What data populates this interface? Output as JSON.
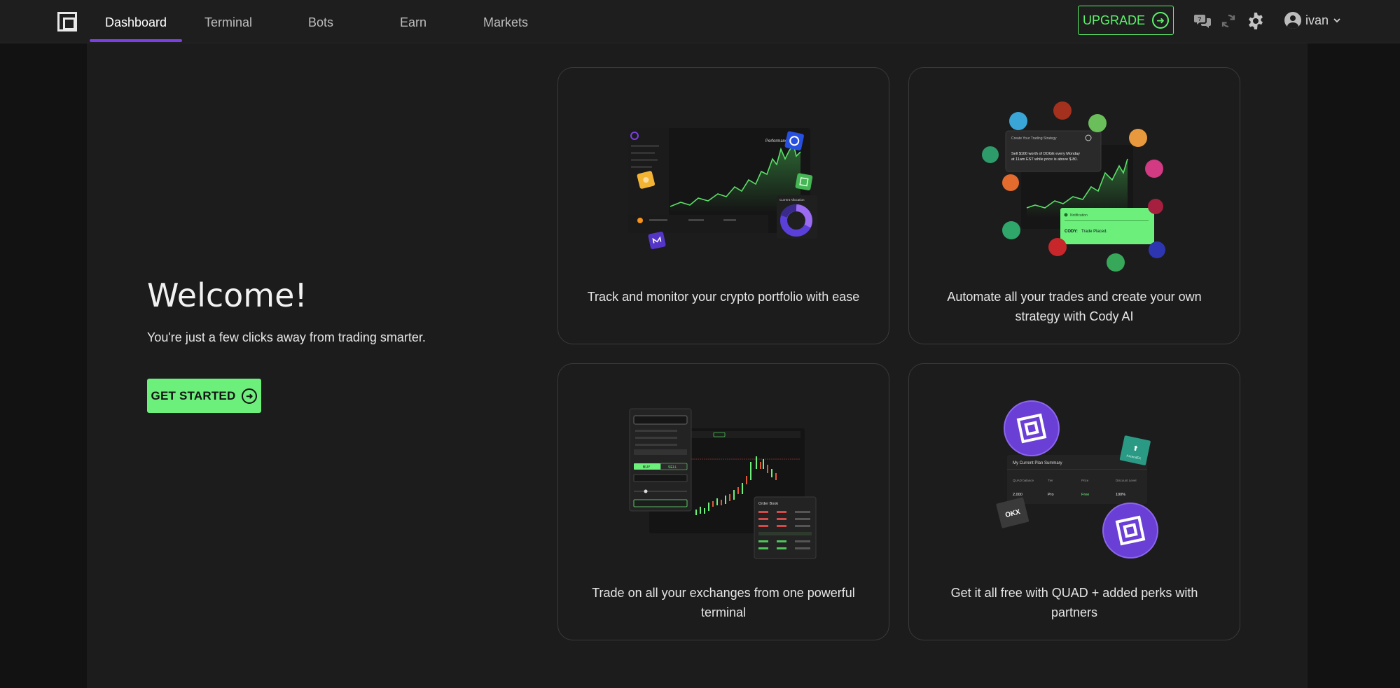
{
  "nav": {
    "items": [
      {
        "label": "Dashboard",
        "active": true
      },
      {
        "label": "Terminal"
      },
      {
        "label": "Bots"
      },
      {
        "label": "Earn"
      },
      {
        "label": "Markets"
      }
    ]
  },
  "header": {
    "upgrade_label": "UPGRADE",
    "user_name": "ivan"
  },
  "welcome": {
    "title": "Welcome!",
    "subtitle": "You're just a few clicks away from trading smarter.",
    "cta_label": "GET STARTED"
  },
  "cards": [
    {
      "text": "Track and monitor your crypto portfolio with ease"
    },
    {
      "text": "Automate all your trades and create your own strategy with Cody AI"
    },
    {
      "text": "Trade on all your exchanges from one powerful terminal"
    },
    {
      "text": "Get it all free with QUAD + added perks with partners"
    }
  ],
  "illustrations": {
    "portfolio": {
      "performance_label": "Performance",
      "allocation_label": "Current Allocation"
    },
    "cody": {
      "strategy_title": "Create Your Trading Strategy",
      "strategy_text_1": "Sell $100 worth of DOGE every Monday",
      "strategy_text_2": "at 11am EST while price is above $.80.",
      "notification_label": "Notification",
      "cody_prefix": "CODY:",
      "cody_message": "Trade Placed."
    },
    "terminal": {
      "order_book_label": "Order Book",
      "buy_label": "BUY",
      "sell_label": "SELL"
    },
    "plan": {
      "title": "My Current Plan Summary",
      "headers": [
        "QUAD balance",
        "Tier",
        "Price",
        "Discount Level"
      ],
      "values": [
        "2,000",
        "Pro",
        "Free",
        "100%"
      ],
      "okx_label": "OKX",
      "ascendex_label": "AscendEX"
    }
  },
  "colors": {
    "accent_green": "#6cf07b",
    "active_tab_purple": "#7c3fe4",
    "card_border": "#3a3a3a"
  },
  "icons": {
    "logo": "quad-logo-icon",
    "support": "chat-bubbles-icon",
    "sync": "refresh-icon",
    "settings": "gear-icon",
    "user": "user-circle-icon",
    "dropdown": "chevron-down-icon"
  }
}
